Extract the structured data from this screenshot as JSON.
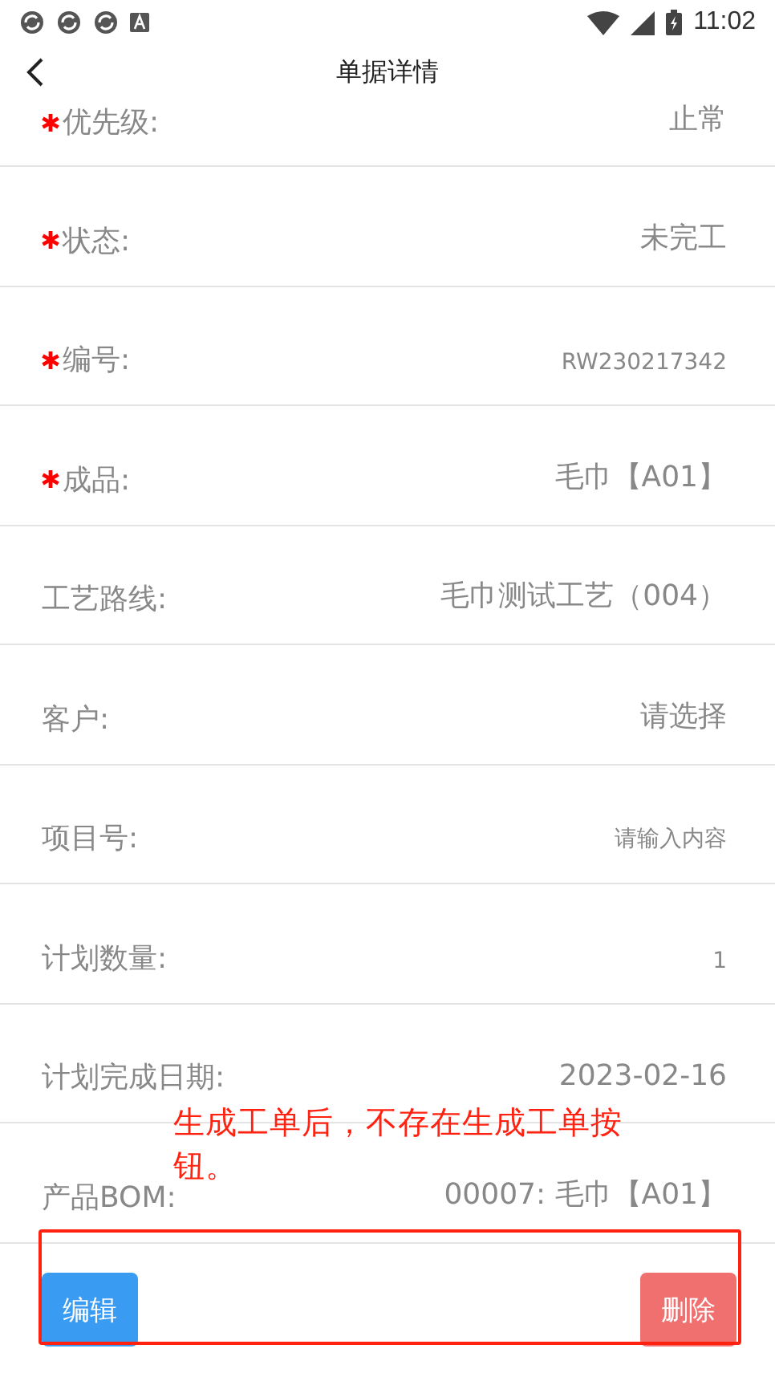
{
  "status_bar": {
    "time": "11:02"
  },
  "header": {
    "title": "单据详情"
  },
  "fields": [
    {
      "label": "优先级:",
      "value": "止常",
      "required": true,
      "kind": "plain"
    },
    {
      "label": "状态:",
      "value": "未完工",
      "required": true,
      "kind": "plain"
    },
    {
      "label": "编号:",
      "value": "RW230217342",
      "required": true,
      "kind": "compact"
    },
    {
      "label": "成品:",
      "value": "毛巾【A01】",
      "required": true,
      "kind": "plain"
    },
    {
      "label": "工艺路线:",
      "value": "毛巾测试工艺（004）",
      "required": false,
      "kind": "plain"
    },
    {
      "label": "客户:",
      "value": "请选择",
      "required": false,
      "kind": "plain"
    },
    {
      "label": "项目号:",
      "value": "请输入内容",
      "required": false,
      "kind": "compact"
    },
    {
      "label": "计划数量:",
      "value": "1",
      "required": false,
      "kind": "compact"
    },
    {
      "label": "计划完成日期:",
      "value": "2023-02-16",
      "required": false,
      "kind": "plain"
    },
    {
      "label": "产品BOM:",
      "value": "00007: 毛巾【A01】",
      "required": false,
      "kind": "plain"
    }
  ],
  "buttons": [
    {
      "label": "编辑",
      "kind": "primary"
    },
    {
      "label": "删除",
      "kind": "danger"
    }
  ],
  "annotation": {
    "text": "生成工单后，不存在生成工单按钮。"
  }
}
